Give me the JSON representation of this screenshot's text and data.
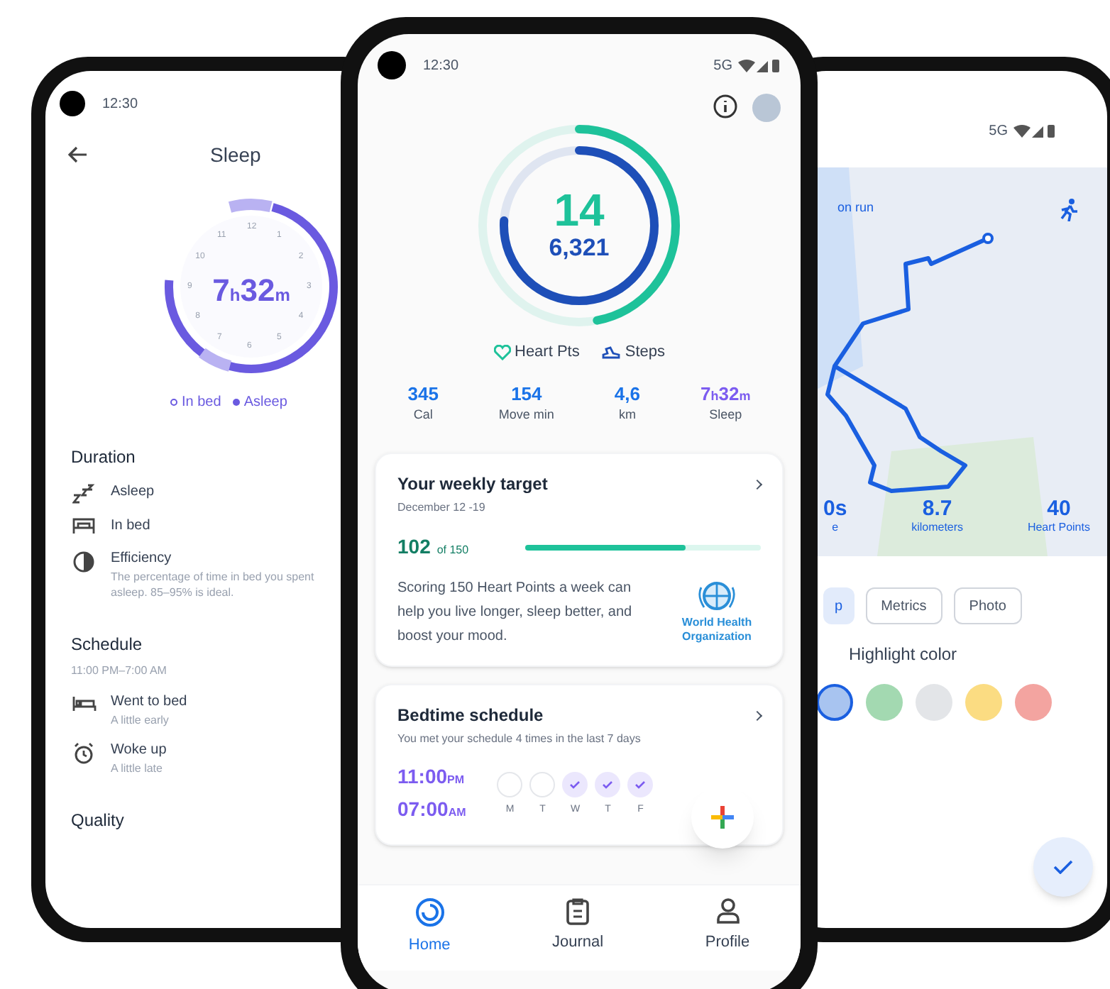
{
  "sleep_screen": {
    "status_time": "12:30",
    "title": "Sleep",
    "dial_labels": [
      "12",
      "1",
      "2",
      "3",
      "4",
      "5",
      "6",
      "7",
      "8",
      "9",
      "10",
      "11"
    ],
    "total": [
      {
        "value": "7",
        "unit": "h"
      },
      {
        "value": "32",
        "unit": "m"
      }
    ],
    "legend": [
      {
        "label": "In bed",
        "kind": "outline"
      },
      {
        "label": "Asleep",
        "kind": "filled"
      }
    ],
    "sections": [
      {
        "title": "Duration",
        "items": [
          {
            "label": "Asleep"
          },
          {
            "label": "In bed"
          },
          {
            "label": "Efficiency",
            "detail": "The percentage of time in bed you spent asleep. 85–95% is ideal."
          }
        ]
      },
      {
        "title": "Schedule",
        "subtitle": "11:00 PM–7:00 AM",
        "items": [
          {
            "label": "Went to bed",
            "detail": "A little early"
          },
          {
            "label": "Woke up",
            "detail": "A little late"
          }
        ]
      },
      {
        "title": "Quality"
      }
    ]
  },
  "home_screen": {
    "status_time": "12:30",
    "network": "5G",
    "rings": [
      {
        "value": "14",
        "level": 0.47,
        "color": "#1ec29a"
      },
      {
        "value": "6,321",
        "level": 0.76,
        "color": "#1e4fb8"
      }
    ],
    "ring_legend": [
      {
        "label": "Heart Pts",
        "kind": "heart"
      },
      {
        "label": "Steps",
        "kind": "steps"
      }
    ],
    "stats": [
      {
        "parts": [
          {
            "value": "345"
          }
        ],
        "label": "Cal",
        "kind": "plain"
      },
      {
        "parts": [
          {
            "value": "154"
          }
        ],
        "label": "Move min",
        "kind": "plain"
      },
      {
        "parts": [
          {
            "value": "4,6"
          }
        ],
        "label": "km",
        "kind": "plain"
      },
      {
        "parts": [
          {
            "value": "7",
            "unit": "h"
          },
          {
            "value": "32",
            "unit": "m"
          }
        ],
        "label": "Sleep",
        "kind": "sleep"
      }
    ],
    "weekly_target": {
      "title": "Your weekly target",
      "dates": "December 12 -19",
      "score": "102",
      "goal": "of 150",
      "level": 0.68,
      "text": "Scoring 150 Heart Points a week can help you live longer, sleep better, and boost your mood.",
      "logo_text": [
        "World Health",
        "Organization"
      ]
    },
    "bedtime": {
      "title": "Bedtime schedule",
      "subtitle": "You met your schedule 4 times in the last 7 days",
      "times": [
        {
          "value": "11:00",
          "unit": "PM"
        },
        {
          "value": "07:00",
          "unit": "AM"
        }
      ],
      "days": [
        {
          "label": "M",
          "checked": false
        },
        {
          "label": "T",
          "checked": false
        },
        {
          "label": "W",
          "checked": true
        },
        {
          "label": "T",
          "checked": true
        },
        {
          "label": "F",
          "checked": true
        }
      ]
    },
    "nav": [
      {
        "label": "Home",
        "selected": true
      },
      {
        "label": "Journal",
        "selected": false
      },
      {
        "label": "Profile",
        "selected": false
      }
    ]
  },
  "activity_screen": {
    "network": "5G",
    "map_label": "on run",
    "stats": [
      {
        "value": "0s",
        "label": "e"
      },
      {
        "value": "8.7",
        "label": "kilometers"
      },
      {
        "value": "40",
        "label": "Heart Points"
      }
    ],
    "chips": [
      {
        "label": "p",
        "selected": true
      },
      {
        "label": "Metrics",
        "selected": false
      },
      {
        "label": "Photo",
        "selected": false
      }
    ],
    "highlight_title": "Highlight color",
    "swatches": [
      {
        "color": "#a8c4f0",
        "selected": true
      },
      {
        "color": "#a3d9b1",
        "selected": false
      },
      {
        "color": "#e3e5e8",
        "selected": false
      },
      {
        "color": "#fbdc82",
        "selected": false
      },
      {
        "color": "#f3a4a0",
        "selected": false
      }
    ]
  }
}
